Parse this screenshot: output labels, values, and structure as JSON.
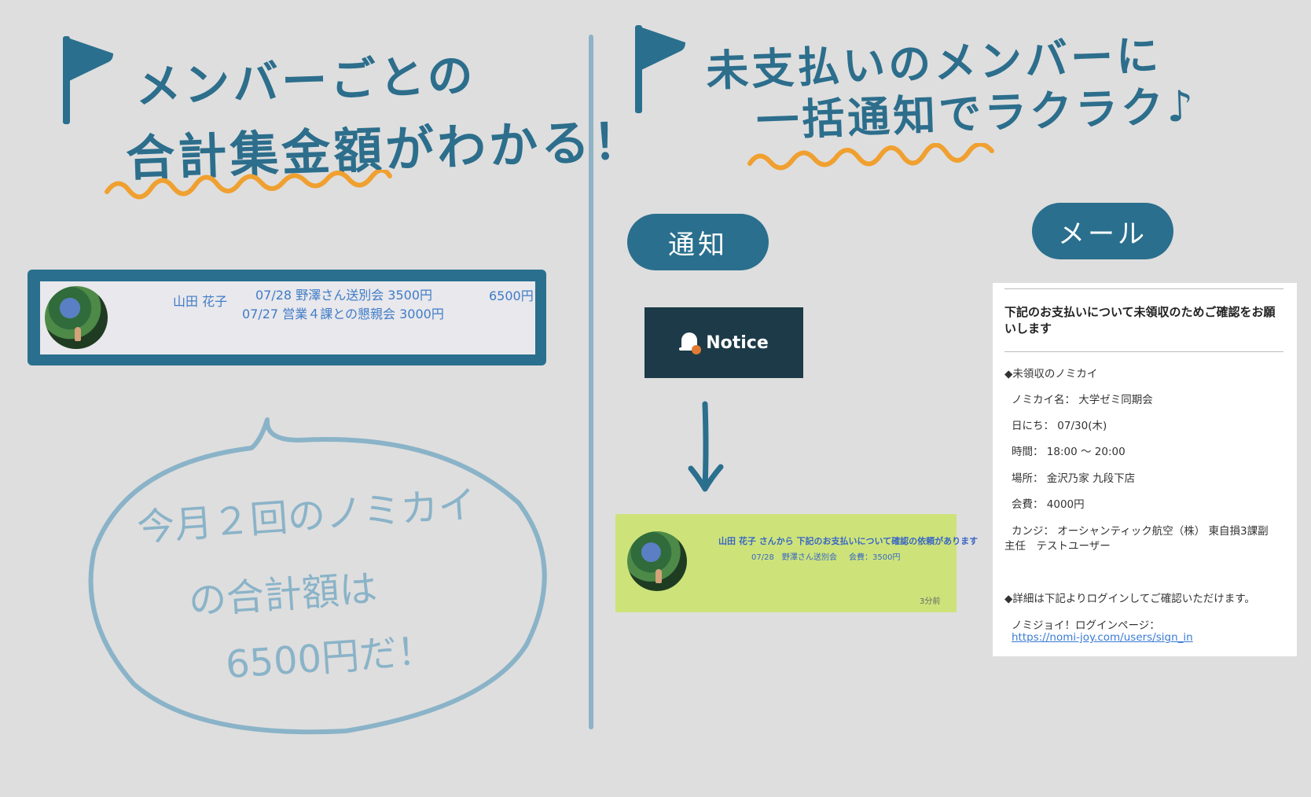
{
  "left_heading": {
    "line1": "メンバーごとの",
    "line2": "合計集金額がわかる！"
  },
  "right_heading": {
    "line1": "未支払いのメンバーに",
    "line2": "一括通知でラクラク♪"
  },
  "member_row": {
    "name": "山田 花子",
    "events": [
      "07/28 野澤さん送別会 3500円",
      "07/27 営業４課との懇親会 3000円"
    ],
    "total": "6500円"
  },
  "bubble": {
    "line1": "今月２回のノミカイ",
    "line2": "の合計額は",
    "line3": "6500円だ！"
  },
  "labels": {
    "notification": "通知",
    "mail": "メール"
  },
  "notice_button": {
    "label": "Notice"
  },
  "notification": {
    "name": "山田 花子",
    "message": "さんから 下記のお支払いについて確認の依頼があります",
    "event": "07/28　野澤さん送別会",
    "fee": "会費：3500円",
    "time": "3分前"
  },
  "mail": {
    "subject": "下記のお支払いについて未領収のためご確認をお願いします",
    "section_title": "◆未領収のノミカイ",
    "name_row": "ノミカイ名： 大学ゼミ同期会",
    "date_row": "日にち： 07/30(木)",
    "time_row": "時間： 18:00 〜 20:00",
    "place_row": "場所： 金沢乃家 九段下店",
    "fee_row": "会費： 4000円",
    "kanji_row_1": "カンジ： オーシャンティック航空（株） 東自損3課副",
    "kanji_row_2": "主任　テストユーザー",
    "detail_note": "◆詳細は下記よりログインしてご確認いただけます。",
    "login_label": "ノミジョイ！ログインページ：",
    "login_link": "https://nomi-joy.com/users/sign_in"
  },
  "colors": {
    "background": "#dedede",
    "accent_blue": "#2a6f8e",
    "light_blue": "#8ab3c8",
    "underline_orange": "#f0a030",
    "notice_dark": "#1c3a47",
    "notification_green": "#cde37a",
    "link_blue": "#3a66c4"
  },
  "icons": {
    "flag": "flag-icon",
    "bell": "bell-icon",
    "arrow": "arrow-down-icon",
    "music_note": "music-note-icon"
  }
}
